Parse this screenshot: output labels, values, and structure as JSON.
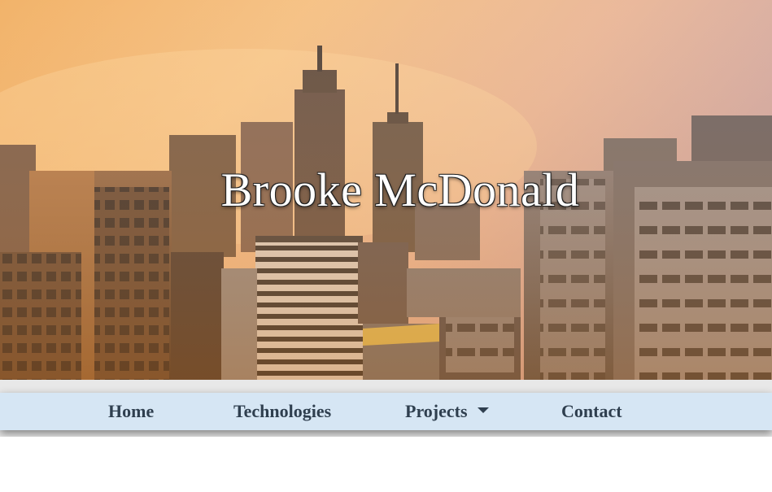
{
  "hero": {
    "title": "Brooke McDonald",
    "image": "city-skyline-sunset",
    "colors": {
      "sky_top": "#f3b36a",
      "sky_mid": "#e8a15c",
      "sky_right": "#c79b93",
      "title": "#ffffff"
    }
  },
  "navbar": {
    "background": "#d6e6f4",
    "items": [
      {
        "label": "Home"
      },
      {
        "label": "Technologies"
      },
      {
        "label": "Projects",
        "icon": "caret-down-icon"
      },
      {
        "label": "Contact"
      }
    ]
  }
}
